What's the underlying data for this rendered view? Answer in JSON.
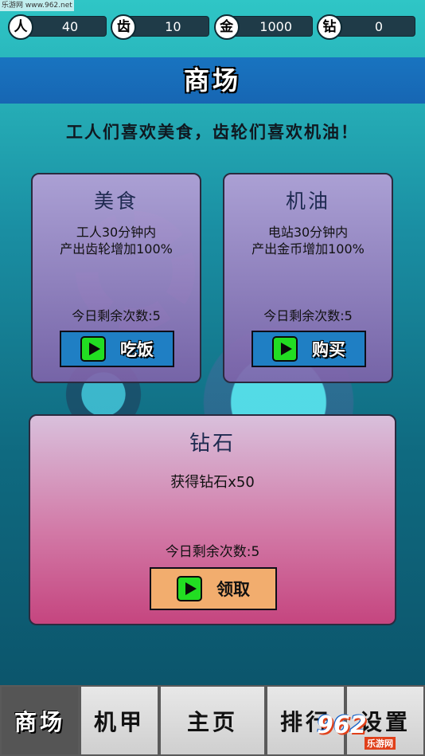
{
  "watermark": "乐游网 www.962.net",
  "resources": [
    {
      "icon_text": "人",
      "icon": "worker-icon",
      "value": "40"
    },
    {
      "icon_text": "齿",
      "icon": "gear-icon",
      "value": "10"
    },
    {
      "icon_text": "金",
      "icon": "gold-icon",
      "value": "1000"
    },
    {
      "icon_text": "钻",
      "icon": "diamond-icon",
      "value": "0"
    }
  ],
  "header": {
    "title": "商场"
  },
  "subtitle": "工人们喜欢美食，齿轮们喜欢机油！",
  "cards": {
    "food": {
      "name": "美食",
      "desc": "工人30分钟内\n产出齿轮增加100%",
      "remain": "今日剩余次数:5",
      "button": "吃饭"
    },
    "oil": {
      "name": "机油",
      "desc": "电站30分钟内\n产出金币增加100%",
      "remain": "今日剩余次数:5",
      "button": "购买"
    },
    "diamond": {
      "name": "钻石",
      "desc": "获得钻石x50",
      "remain": "今日剩余次数:5",
      "button": "领取"
    }
  },
  "tabs": [
    {
      "label": "商场",
      "active": true
    },
    {
      "label": "机甲",
      "active": false
    },
    {
      "label": "主页",
      "active": false
    },
    {
      "label": "排行",
      "active": false
    },
    {
      "label": "设置",
      "active": false
    }
  ],
  "logo": {
    "main": "962",
    "sub": "乐游网"
  },
  "colors": {
    "accent": "#1874c0",
    "play": "#22dd22",
    "diamond_btn": "#f2ad6e"
  }
}
